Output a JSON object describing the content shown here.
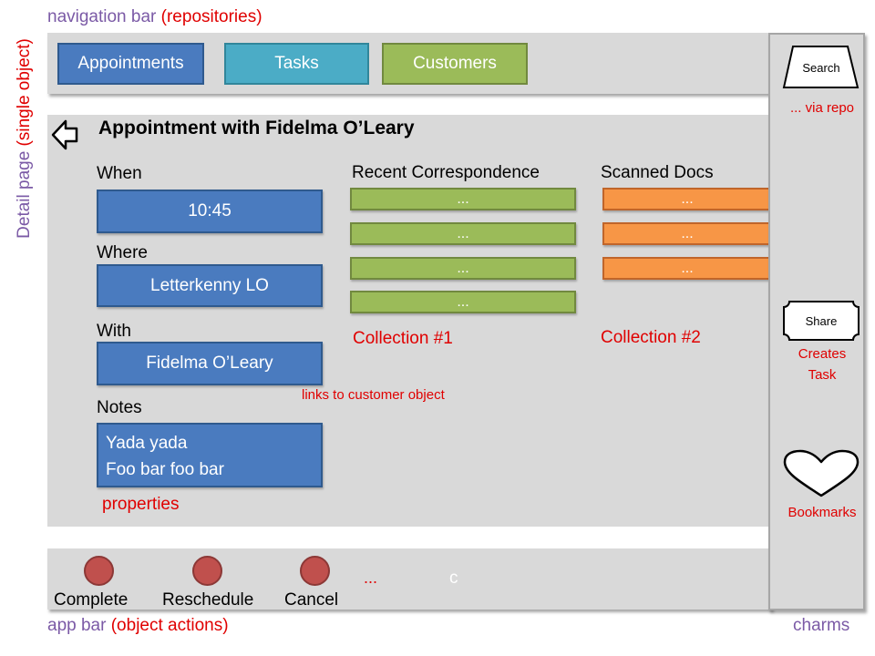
{
  "captions": {
    "nav_prefix": "navigation bar",
    "nav_suffix": "(repositories)",
    "detail_prefix": "Detail page",
    "detail_suffix": "(single object)",
    "appbar_prefix": "app bar",
    "appbar_suffix": "(object actions)",
    "charms": "charms"
  },
  "nav": {
    "tiles": [
      "Appointments",
      "Tasks",
      "Customers"
    ],
    "colors": {
      "appointments": "#4a7bbf",
      "tasks": "#4bacc6",
      "customers": "#9bbb59"
    }
  },
  "detail": {
    "title": "Appointment with Fidelma O’Leary",
    "when_label": "When",
    "when_value": "10:45",
    "where_label": "Where",
    "where_value": "Letterkenny LO",
    "with_label": "With",
    "with_value": "Fidelma O’Leary",
    "with_note": "links to customer object",
    "notes_label": "Notes",
    "notes_lines": [
      "Yada yada",
      "Foo bar foo bar"
    ],
    "properties_note": "properties"
  },
  "collections": {
    "recent": {
      "header": "Recent Correspondence",
      "items": [
        "...",
        "...",
        "...",
        "..."
      ],
      "note": "Collection #1",
      "color": "#9bbb59"
    },
    "scanned": {
      "header": "Scanned Docs",
      "items": [
        "...",
        "...",
        "..."
      ],
      "note": "Collection #2",
      "color": "#f79646"
    }
  },
  "app_bar": {
    "actions": [
      "Complete",
      "Reschedule",
      "Cancel"
    ],
    "more": "...",
    "extra": "c"
  },
  "charms": {
    "search": "Search",
    "search_note": "... via repo",
    "share": "Share",
    "share_note_line1": "Creates",
    "share_note_line2": "Task",
    "bookmarks_note": "Bookmarks",
    "bookmarks_icon": "heart-icon"
  }
}
